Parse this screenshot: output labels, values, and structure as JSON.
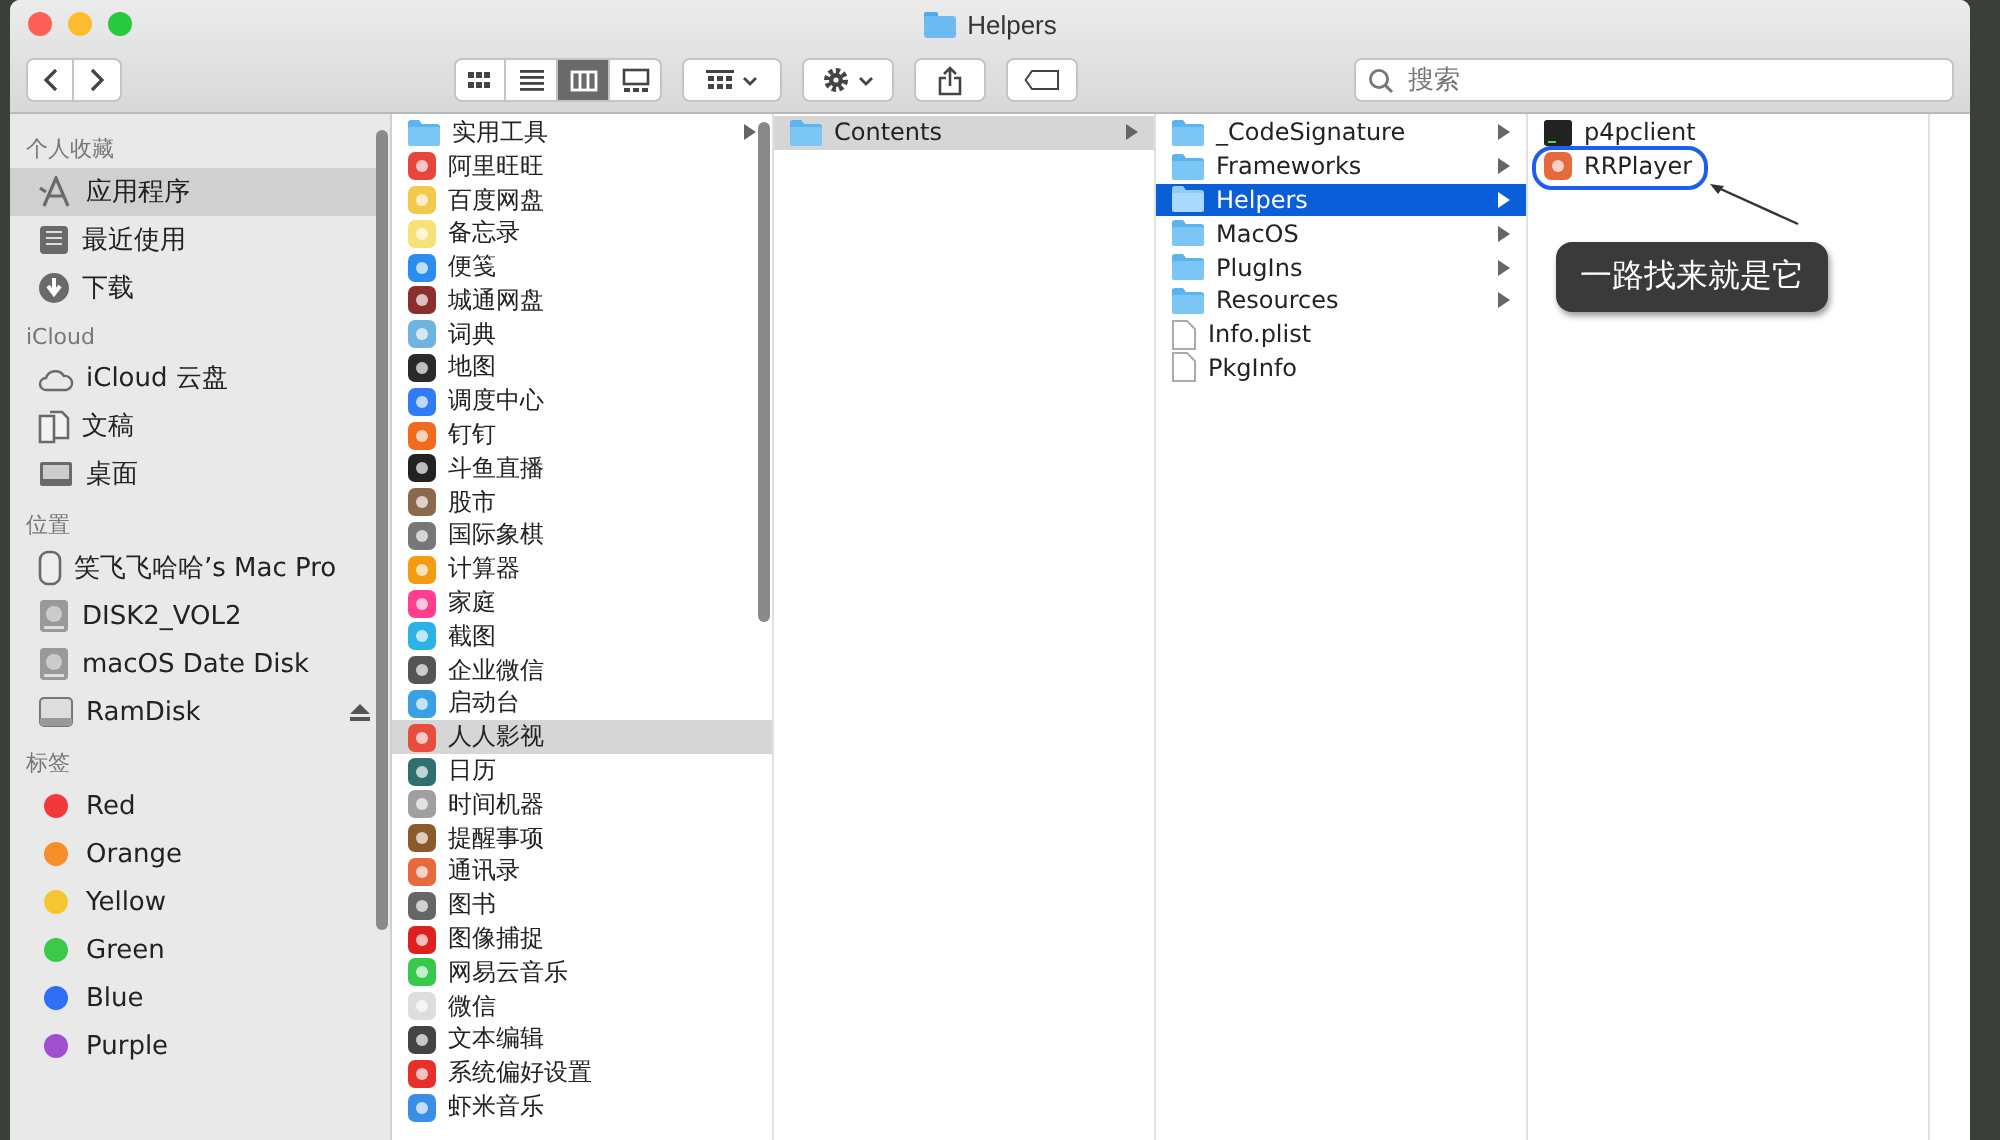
{
  "window": {
    "title": "Helpers"
  },
  "toolbar": {
    "view_buttons": [
      {
        "kind": "icons",
        "selected": false
      },
      {
        "kind": "list",
        "selected": false
      },
      {
        "kind": "columns",
        "selected": true
      },
      {
        "kind": "gallery",
        "selected": false
      }
    ],
    "search": {
      "placeholder": "搜索"
    }
  },
  "sidebar": {
    "sections": [
      {
        "heading": "个人收藏",
        "items": [
          {
            "label": "应用程序",
            "kind": "apps",
            "selected": true
          },
          {
            "label": "最近使用",
            "kind": "recent",
            "selected": false
          },
          {
            "label": "下载",
            "kind": "download",
            "selected": false
          }
        ]
      },
      {
        "heading": "iCloud",
        "items": [
          {
            "label": "iCloud 云盘",
            "kind": "cloud",
            "selected": false
          },
          {
            "label": "文稿",
            "kind": "docs",
            "selected": false
          },
          {
            "label": "桌面",
            "kind": "desktop",
            "selected": false
          }
        ]
      },
      {
        "heading": "位置",
        "items": [
          {
            "label": "笑飞飞哈哈’s Mac Pro",
            "kind": "computer",
            "selected": false
          },
          {
            "label": "DISK2_VOL2",
            "kind": "disk",
            "selected": false
          },
          {
            "label": "macOS Date Disk",
            "kind": "disk",
            "selected": false
          },
          {
            "label": "RamDisk",
            "kind": "ramdisk",
            "selected": false
          }
        ]
      },
      {
        "heading": "标签",
        "items": [
          {
            "label": "Red",
            "kind": "tag",
            "selected": false,
            "color": "#f2383a"
          },
          {
            "label": "Orange",
            "kind": "tag",
            "selected": false,
            "color": "#f68e2a"
          },
          {
            "label": "Yellow",
            "kind": "tag",
            "selected": false,
            "color": "#f7c531"
          },
          {
            "label": "Green",
            "kind": "tag",
            "selected": false,
            "color": "#3cc94a"
          },
          {
            "label": "Blue",
            "kind": "tag",
            "selected": false,
            "color": "#2f6ef6"
          },
          {
            "label": "Purple",
            "kind": "tag",
            "selected": false,
            "color": "#a04fd0"
          }
        ]
      }
    ]
  },
  "columns": [
    {
      "focused": false,
      "items": [
        {
          "label": "实用工具",
          "kind": "folder",
          "selected": false
        },
        {
          "label": "阿里旺旺",
          "kind": "app",
          "selected": false
        },
        {
          "label": "百度网盘",
          "kind": "app",
          "selected": false
        },
        {
          "label": "备忘录",
          "kind": "app",
          "selected": false
        },
        {
          "label": "便笺",
          "kind": "app",
          "selected": false
        },
        {
          "label": "城通网盘",
          "kind": "app",
          "selected": false
        },
        {
          "label": "词典",
          "kind": "app",
          "selected": false
        },
        {
          "label": "地图",
          "kind": "app",
          "selected": false
        },
        {
          "label": "调度中心",
          "kind": "app",
          "selected": false
        },
        {
          "label": "钉钉",
          "kind": "app",
          "selected": false
        },
        {
          "label": "斗鱼直播",
          "kind": "app",
          "selected": false
        },
        {
          "label": "股市",
          "kind": "app",
          "selected": false
        },
        {
          "label": "国际象棋",
          "kind": "app",
          "selected": false
        },
        {
          "label": "计算器",
          "kind": "app",
          "selected": false
        },
        {
          "label": "家庭",
          "kind": "app",
          "selected": false
        },
        {
          "label": "截图",
          "kind": "app",
          "selected": false
        },
        {
          "label": "企业微信",
          "kind": "app",
          "selected": false
        },
        {
          "label": "启动台",
          "kind": "app",
          "selected": false
        },
        {
          "label": "人人影视",
          "kind": "app",
          "selected": true
        },
        {
          "label": "日历",
          "kind": "app",
          "selected": false
        },
        {
          "label": "时间机器",
          "kind": "app",
          "selected": false
        },
        {
          "label": "提醒事项",
          "kind": "app",
          "selected": false
        },
        {
          "label": "通讯录",
          "kind": "app",
          "selected": false
        },
        {
          "label": "图书",
          "kind": "app",
          "selected": false
        },
        {
          "label": "图像捕捉",
          "kind": "app",
          "selected": false
        },
        {
          "label": "网易云音乐",
          "kind": "app",
          "selected": false
        },
        {
          "label": "微信",
          "kind": "app",
          "selected": false
        },
        {
          "label": "文本编辑",
          "kind": "app",
          "selected": false
        },
        {
          "label": "系统偏好设置",
          "kind": "app",
          "selected": false
        },
        {
          "label": "虾米音乐",
          "kind": "app",
          "selected": false
        }
      ]
    },
    {
      "focused": false,
      "items": [
        {
          "label": "Contents",
          "kind": "folder",
          "selected": true
        }
      ]
    },
    {
      "focused": true,
      "items": [
        {
          "label": "_CodeSignature",
          "kind": "folder",
          "selected": false
        },
        {
          "label": "Frameworks",
          "kind": "folder",
          "selected": false
        },
        {
          "label": "Helpers",
          "kind": "folder",
          "selected": true
        },
        {
          "label": "MacOS",
          "kind": "folder",
          "selected": false
        },
        {
          "label": "PlugIns",
          "kind": "folder",
          "selected": false
        },
        {
          "label": "Resources",
          "kind": "folder",
          "selected": false
        },
        {
          "label": "Info.plist",
          "kind": "file",
          "selected": false
        },
        {
          "label": "PkgInfo",
          "kind": "file",
          "selected": false
        }
      ]
    },
    {
      "focused": false,
      "items": [
        {
          "label": "p4pclient",
          "kind": "terminal",
          "selected": false,
          "circled": false
        },
        {
          "label": "RRPlayer",
          "kind": "app",
          "selected": false,
          "circled": true
        }
      ]
    }
  ],
  "annotation": {
    "callout": "一路找来就是它"
  }
}
